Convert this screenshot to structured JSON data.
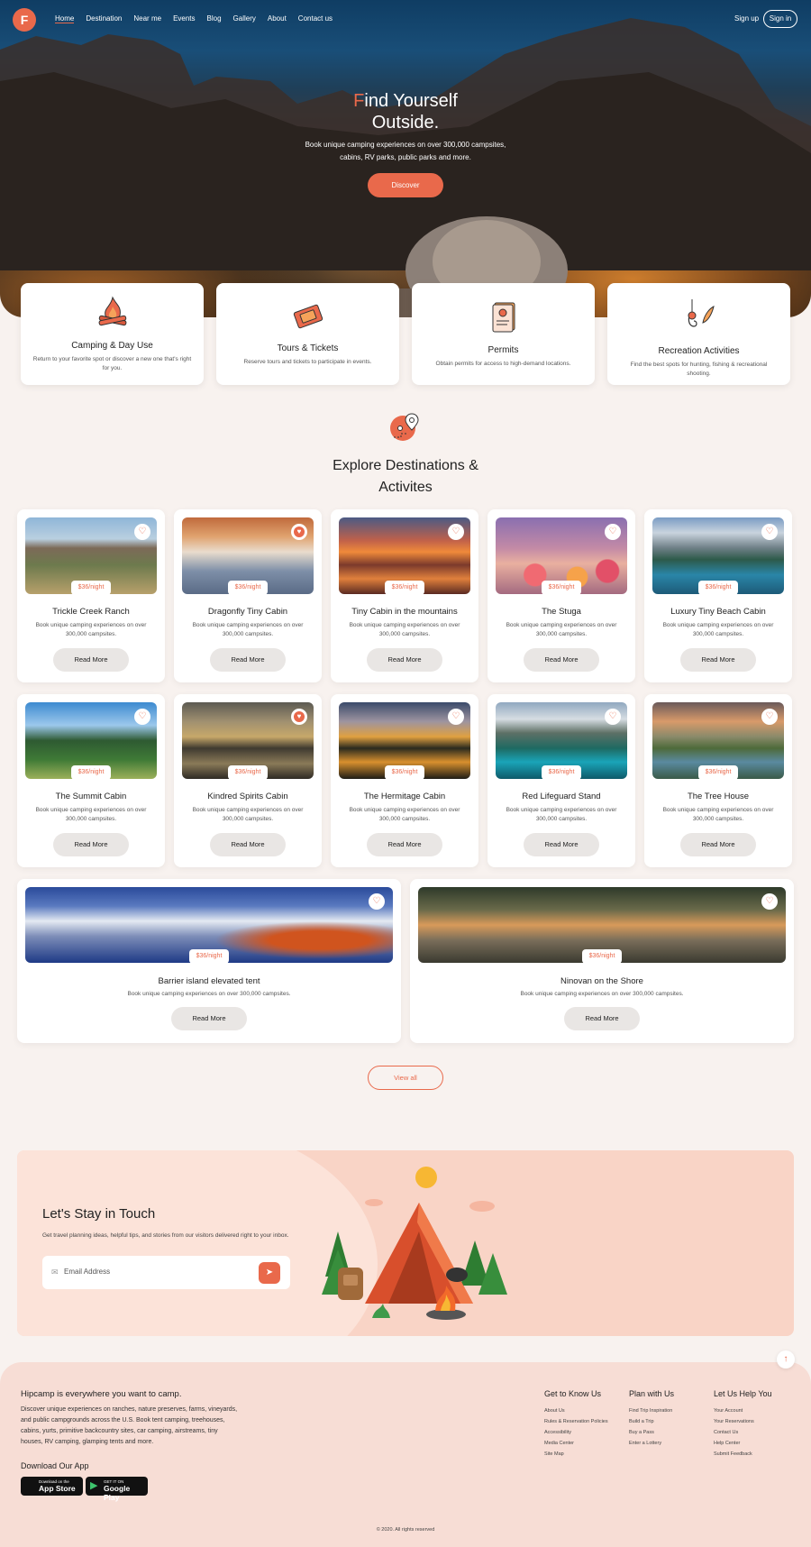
{
  "nav": {
    "logo": "F",
    "links": [
      "Home",
      "Destination",
      "Near me",
      "Events",
      "Blog",
      "Gallery",
      "About",
      "Contact us"
    ],
    "signup": "Sign up",
    "signin": "Sign in"
  },
  "hero": {
    "title_first_letter": "F",
    "title_rest_line1": "ind Yourself",
    "title_line2": "Outside.",
    "subtitle": "Book unique camping experiences on over 300,000 campsites, cabins, RV parks, public parks and more.",
    "cta": "Discover"
  },
  "features": [
    {
      "title": "Camping & Day Use",
      "desc": "Return to your favorite spot or discover a new one that's right for you.",
      "icon": "campfire-icon"
    },
    {
      "title": "Tours & Tickets",
      "desc": "Reserve tours and tickets to participate in events.",
      "icon": "ticket-icon"
    },
    {
      "title": "Permits",
      "desc": "Obtain permits for access to high-demand locations.",
      "icon": "permit-document-icon"
    },
    {
      "title": "Recreation Activities",
      "desc": "Find the best spots for hunting, fishing & recreational shooting.",
      "icon": "fishing-icon"
    }
  ],
  "explore": {
    "title": "Explore Destinations & Activites",
    "icon": "map-pin-icon"
  },
  "destinations": [
    {
      "name": "Trickle Creek Ranch",
      "price": "$36/night",
      "desc": "Book unique camping experiences on over 300,000 campsites.",
      "cta": "Read More",
      "favorite": false
    },
    {
      "name": "Dragonfly Tiny Cabin",
      "price": "$36/night",
      "desc": "Book unique camping experiences on over 300,000 campsites.",
      "cta": "Read More",
      "favorite": true
    },
    {
      "name": "Tiny Cabin in the mountains",
      "price": "$36/night",
      "desc": "Book unique camping experiences on over 300,000 campsites.",
      "cta": "Read More",
      "favorite": false
    },
    {
      "name": "The Stuga",
      "price": "$36/night",
      "desc": "Book unique camping experiences on over 300,000 campsites.",
      "cta": "Read More",
      "favorite": false
    },
    {
      "name": "Luxury Tiny Beach Cabin",
      "price": "$36/night",
      "desc": "Book unique camping experiences on over 300,000 campsites.",
      "cta": "Read More",
      "favorite": false
    },
    {
      "name": "The Summit Cabin",
      "price": "$36/night",
      "desc": "Book unique camping experiences on over 300,000 campsites.",
      "cta": "Read More",
      "favorite": false
    },
    {
      "name": "Kindred Spirits Cabin",
      "price": "$36/night",
      "desc": "Book unique camping experiences on over 300,000 campsites.",
      "cta": "Read More",
      "favorite": true
    },
    {
      "name": "The Hermitage Cabin",
      "price": "$36/night",
      "desc": "Book unique camping experiences on over 300,000 campsites.",
      "cta": "Read More",
      "favorite": false
    },
    {
      "name": "Red Lifeguard Stand",
      "price": "$36/night",
      "desc": "Book unique camping experiences on over 300,000 campsites.",
      "cta": "Read More",
      "favorite": false
    },
    {
      "name": "The Tree House",
      "price": "$36/night",
      "desc": "Book unique camping experiences on over 300,000 campsites.",
      "cta": "Read More",
      "favorite": false
    }
  ],
  "wide_destinations": [
    {
      "name": "Barrier island elevated tent",
      "price": "$36/night",
      "desc": "Book unique camping experiences on over 300,000 campsites.",
      "cta": "Read More",
      "favorite": false
    },
    {
      "name": "Ninovan on the Shore",
      "price": "$36/night",
      "desc": "Book unique camping experiences on over 300,000 campsites.",
      "cta": "Read More",
      "favorite": false
    }
  ],
  "view_all": "View all",
  "newsletter": {
    "title": "Let's Stay in Touch",
    "subtitle": "Get travel planning ideas, helpful tips, and stories from our visitors delivered right to your inbox.",
    "placeholder": "Email Address"
  },
  "footer": {
    "title": "Hipcamp is everywhere you want to camp.",
    "text": "Discover unique experiences on ranches, nature preserves, farms, vineyards, and public campgrounds across the U.S. Book tent camping, treehouses, cabins, yurts, primitive backcountry sites, car camping, airstreams, tiny houses, RV camping, glamping tents and more.",
    "app_title": "Download Our App",
    "app_store": {
      "small": "Download on the",
      "big": "App Store"
    },
    "google_play": {
      "small": "GET IT ON",
      "big": "Google Play"
    },
    "columns": [
      {
        "title": "Get to Know Us",
        "links": [
          "About Us",
          "Rules & Reservation Policies",
          "Accessibility",
          "Media Center",
          "Site Map"
        ]
      },
      {
        "title": "Plan with Us",
        "links": [
          "Find Trip Inspiration",
          "Build a Trip",
          "Buy a Pass",
          "Enter a Lottery"
        ]
      },
      {
        "title": "Let Us Help You",
        "links": [
          "Your Account",
          "Your Reservations",
          "Contact Us",
          "Help Center",
          "Submit Feedback"
        ]
      }
    ],
    "copyright": "© 2020. All rights reserved"
  },
  "colors": {
    "accent": "#e9694b",
    "background": "#f8f2ef",
    "footer": "#f7ddd5"
  }
}
